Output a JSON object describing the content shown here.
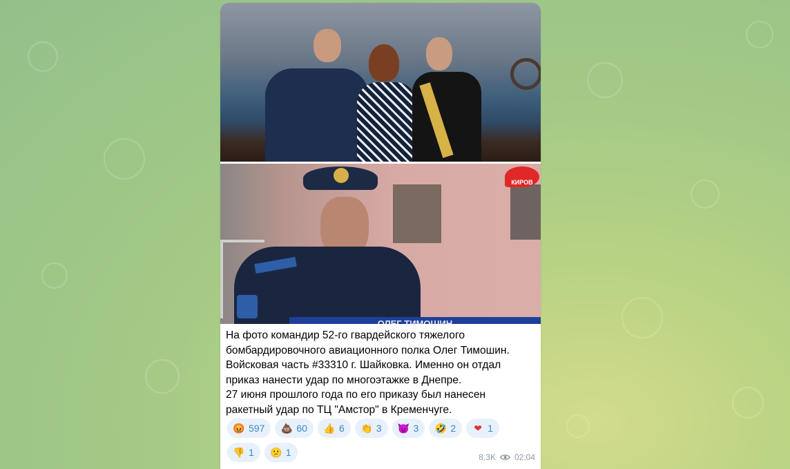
{
  "post": {
    "caption_lines": [
      "На фото командир 52-го гвардейского тяжелого",
      "бомбардировочного авиационного полка Олег Тимошин.",
      "Войсковая часть #33310 г. Шайковка. Именно он отдал",
      "приказ нанести удар по многоэтажке в Днепре.",
      "27 июня прошлого года по его приказу был нанесен",
      "ракетный удар по ТЦ \"Амстор\" в Кременчуге."
    ],
    "photo2_overlay": {
      "logo_text": "КИРОВ",
      "lower_third": "ОЛЕГ ТИМОШИН"
    },
    "reactions_row1": [
      {
        "icon": "angry-face-icon",
        "emoji": "😡",
        "count": "597"
      },
      {
        "icon": "poop-icon",
        "emoji": "💩",
        "count": "60"
      },
      {
        "icon": "thumbs-up-icon",
        "emoji": "👍",
        "count": "6"
      },
      {
        "icon": "clapping-hands-icon",
        "emoji": "👏",
        "count": "3"
      },
      {
        "icon": "devil-face-icon",
        "emoji": "😈",
        "count": "3"
      },
      {
        "icon": "rofl-face-icon",
        "emoji": "🤣",
        "count": "2"
      },
      {
        "icon": "broken-heart-fire-icon",
        "emoji": "❤",
        "count": "1"
      }
    ],
    "reactions_row2": [
      {
        "icon": "thumbs-down-icon",
        "emoji": "👎",
        "count": "1"
      },
      {
        "icon": "confused-face-icon",
        "emoji": "😕",
        "count": "1"
      }
    ],
    "views": "8,3K",
    "time": "02:04"
  },
  "colors": {
    "reaction_bg": "#e8f1fb",
    "reaction_text": "#3a87c9",
    "meta_text": "#8e9aa5"
  }
}
